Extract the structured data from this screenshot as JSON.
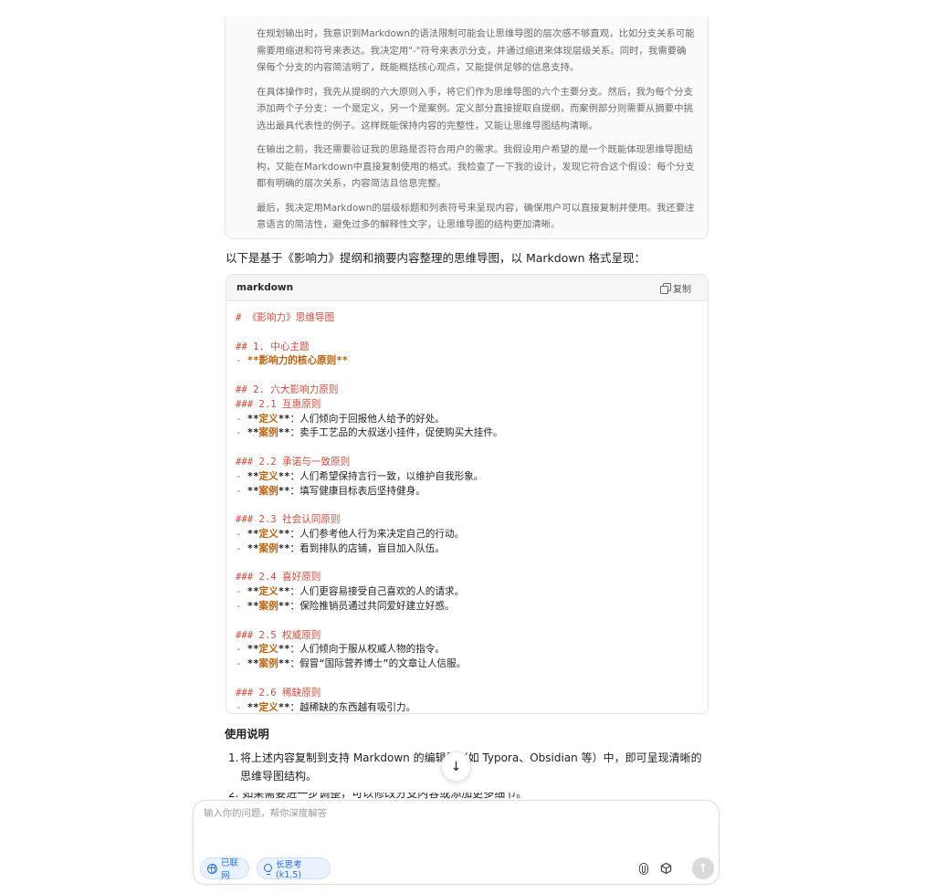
{
  "thinking": {
    "paragraphs": [
      "在规划输出时，我意识到Markdown的语法限制可能会让思维导图的层次感不够直观，比如分支关系可能需要用缩进和符号来表达。我决定用\"-\"符号来表示分支，并通过缩进来体现层级关系。同时，我需要确保每个分支的内容简洁明了，既能概括核心观点，又能提供足够的信息支持。",
      "在具体操作时，我先从提纲的六大原则入手，将它们作为思维导图的六个主要分支。然后，我为每个分支添加两个子分支：一个是定义，另一个是案例。定义部分直接提取自提纲，而案例部分则需要从摘要中挑选出最具代表性的例子。这样既能保持内容的完整性，又能让思维导图结构清晰。",
      "在输出之前，我还需要验证我的思路是否符合用户的需求。我假设用户希望的是一个既能体现思维导图结构，又能在Markdown中直接复制使用的格式。我检查了一下我的设计，发现它符合这个假设：每个分支都有明确的层次关系，内容简洁且信息完整。",
      "最后，我决定用Markdown的层级标题和列表符号来呈现内容，确保用户可以直接复制并使用。我还要注意语言的简洁性，避免过多的解释性文字，让思维导图的结构更加清晰。"
    ]
  },
  "intro": "以下是基于《影响力》提纲和摘要内容整理的思维导图，以 Markdown 格式呈现：",
  "code_block": {
    "language": "markdown",
    "copy_label": "复制",
    "title_line": "# 《影响力》思维导图",
    "section1": "## 1. 中心主题",
    "core_bold": "**影响力的核心原则**",
    "section2": "## 2. 六大影响力原则",
    "definition_label": "定义",
    "case_label": "案例",
    "principles": [
      {
        "heading": "### 2.1 互惠原则",
        "definition": "：人们倾向于回报他人给予的好处。",
        "case": "：卖手工艺品的大叔送小挂件，促使购买大挂件。"
      },
      {
        "heading": "### 2.2 承诺与一致原则",
        "definition": "：人们希望保持言行一致，以维护自我形象。",
        "case": "：填写健康目标表后坚持健身。"
      },
      {
        "heading": "### 2.3 社会认同原则",
        "definition": "：人们参考他人行为来决定自己的行动。",
        "case": "：看到排队的店铺，盲目加入队伍。"
      },
      {
        "heading": "### 2.4 喜好原则",
        "definition": "：人们更容易接受自己喜欢的人的请求。",
        "case": "：保险推销员通过共同爱好建立好感。"
      },
      {
        "heading": "### 2.5 权威原则",
        "definition": "：人们倾向于服从权威人物的指令。",
        "case": "：假冒“国际营养博士”的文章让人信服。"
      },
      {
        "heading": "### 2.6 稀缺原则",
        "definition": "：越稀缺的东西越有吸引力。"
      }
    ]
  },
  "usage": {
    "title": "使用说明",
    "items": [
      {
        "num": "1.",
        "text": "将上述内容复制到支持 Markdown 的编辑器（如 Typora、Obsidian 等）中，即可呈现清晰的思维导图结构。"
      },
      {
        "num": "2.",
        "text": "如果需要进一步调整，可以修改分支内容或添加更多细节。"
      }
    ]
  },
  "input": {
    "placeholder": "输入你的问题，帮你深度解答",
    "web_label": "已联网",
    "think_label": "长思考 (k1.5)"
  },
  "scroll_arrow": "↓",
  "send_arrow": "↑"
}
